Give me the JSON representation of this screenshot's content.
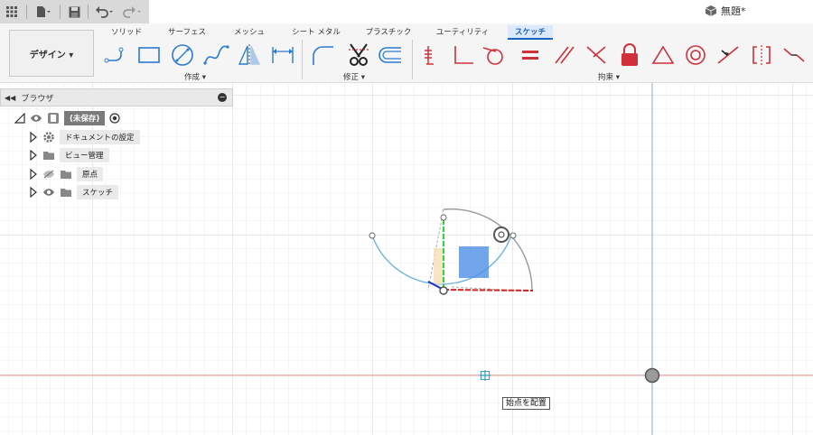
{
  "document": {
    "title": "無題*"
  },
  "ribbon": {
    "workspace_label": "デザイン ▾",
    "tabs": [
      {
        "label": "ソリッド",
        "active": false
      },
      {
        "label": "サーフェス",
        "active": false
      },
      {
        "label": "メッシュ",
        "active": false
      },
      {
        "label": "シート メタル",
        "active": false
      },
      {
        "label": "プラスチック",
        "active": false
      },
      {
        "label": "ユーティリティ",
        "active": false
      },
      {
        "label": "スケッチ",
        "active": true
      }
    ],
    "groups": {
      "create": "作成 ▾",
      "modify": "修正 ▾",
      "constraints": "拘束 ▾"
    }
  },
  "browser": {
    "title": "ブラウザ",
    "root": "(未保存)",
    "items": [
      {
        "label": "ドキュメントの設定",
        "icon": "gear-icon"
      },
      {
        "label": "ビュー管理",
        "icon": "folder-icon"
      },
      {
        "label": "原点",
        "icon": "folder-icon"
      },
      {
        "label": "スケッチ",
        "icon": "folder-icon"
      }
    ]
  },
  "canvas": {
    "tooltip": "始点を配置"
  },
  "colors": {
    "accent": "#1a63c4",
    "constraint_red": "#d0303a",
    "sketch_line": "#6ab7dd",
    "grid": "#e4e4e4",
    "grid_major": "#cfcfcf"
  }
}
